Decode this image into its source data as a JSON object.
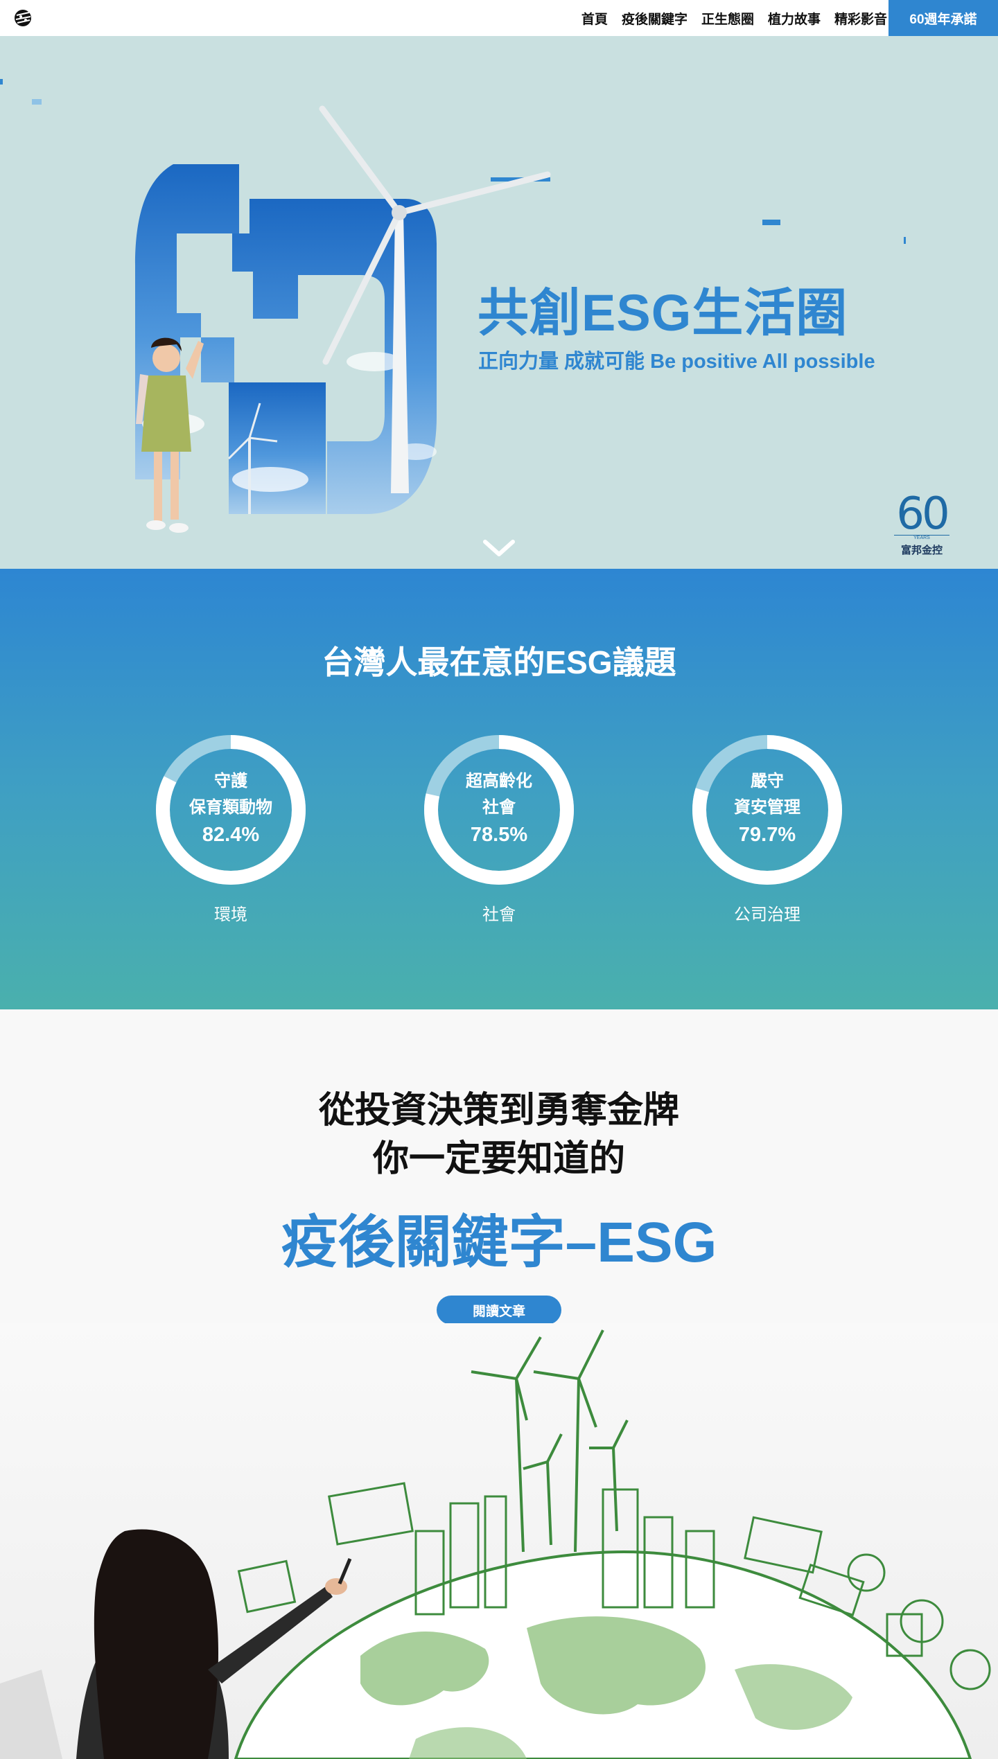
{
  "nav": {
    "logo_icon": "fubon-logo-icon",
    "items": [
      {
        "label": "首頁"
      },
      {
        "label": "疫後關鍵字"
      },
      {
        "label": "正生態圈"
      },
      {
        "label": "植力故事"
      },
      {
        "label": "精彩影音"
      }
    ],
    "cta_label": "60週年承諾"
  },
  "hero": {
    "title": "共創ESG生活圈",
    "subtitle": "正向力量 成就可能  Be positive All possible",
    "scroll_icon": "chevron-down-icon",
    "badge": {
      "number": "60",
      "years": "YEARS",
      "name": "富邦金控"
    }
  },
  "stats": {
    "title": "台灣人最在意的ESG議題",
    "items": [
      {
        "label_line1": "守護",
        "label_line2": "保育類動物",
        "value": "82.4%",
        "percent": 82.4,
        "category": "環境"
      },
      {
        "label_line1": "超高齡化",
        "label_line2": "社會",
        "value": "78.5%",
        "percent": 78.5,
        "category": "社會"
      },
      {
        "label_line1": "嚴守",
        "label_line2": "資安管理",
        "value": "79.7%",
        "percent": 79.7,
        "category": "公司治理"
      }
    ]
  },
  "article": {
    "line1": "從投資決策到勇奪金牌",
    "line2": "你一定要知道的",
    "line3": "疫後關鍵字–ESG",
    "button_label": "閱讀文章"
  },
  "colors": {
    "brand_blue": "#2f86d0",
    "hero_bg": "#c9e0e0",
    "ring_track": "#9ed0e3",
    "illustration_green": "#3d8b3d"
  }
}
